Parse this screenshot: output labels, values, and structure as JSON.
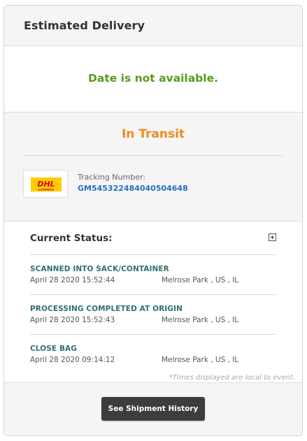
{
  "header": {
    "title": "Estimated Delivery"
  },
  "delivery": {
    "date_text": "Date is not available."
  },
  "shipment": {
    "status": "In Transit",
    "carrier_logo": {
      "text": "DHL",
      "subtext": "eCOMMERCE",
      "color": "#d40511",
      "bg": "#ffcc00"
    },
    "tracking_label": "Tracking Number:",
    "tracking_number": "GM545322484040504648"
  },
  "current_status": {
    "title": "Current Status:",
    "events": [
      {
        "title": "SCANNED INTO SACK/CONTAINER",
        "time": "April 28 2020 15:52:44",
        "location": "Melrose Park , US , IL"
      },
      {
        "title": "PROCESSING COMPLETED AT ORIGIN",
        "time": "April 28 2020 15:52:43",
        "location": "Melrose Park , US , IL"
      },
      {
        "title": "CLOSE BAG",
        "time": "April 28 2020 09:14:12",
        "location": "Melrose Park , US , IL"
      }
    ],
    "note": "*Times displayed are local to event."
  },
  "footer": {
    "history_button": "See Shipment History"
  },
  "colors": {
    "date_green": "#5a9a1e",
    "transit_orange": "#f08a1c",
    "link_blue": "#2a6fc0",
    "event_teal": "#2f6f6f",
    "button_dark": "#3d3d3d"
  }
}
